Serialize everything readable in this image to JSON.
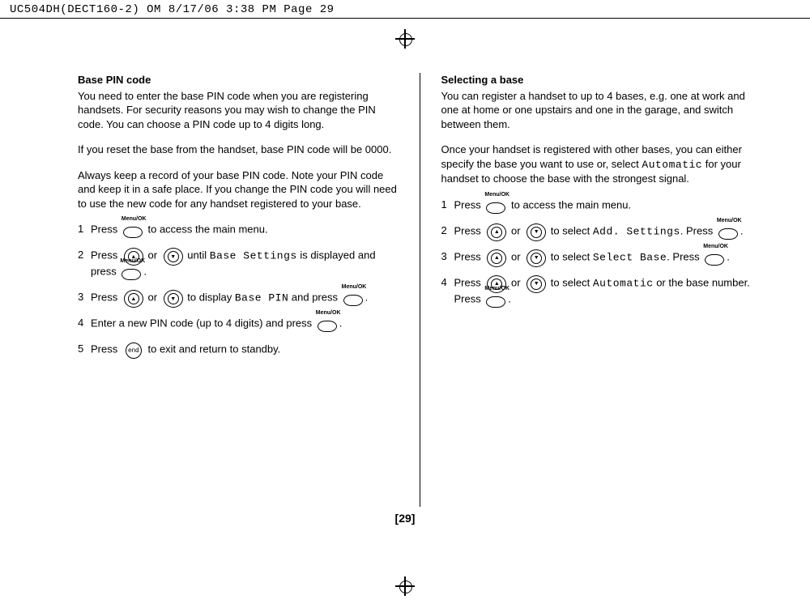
{
  "header": "UC504DH(DECT160-2) OM  8/17/06  3:38 PM  Page 29",
  "page_number": "[29]",
  "left": {
    "title": "Base PIN code",
    "p1": "You need to enter the base PIN code when you are registering handsets. For security reasons you may wish to change the PIN code. You can choose a PIN code up to 4 digits long.",
    "p2": "If you reset the base from the handset, base PIN code will be 0000.",
    "p3": "Always keep a record of your base PIN code. Note your PIN code and keep it in a safe place. If you change the PIN code you will need to use the new code for any handset registered to your base.",
    "s1a": "Press",
    "s1b": "to access the main menu.",
    "s2a": "Press",
    "s2b": "or",
    "s2c": "until",
    "s2d": "Base Settings",
    "s2e": "is displayed and press",
    "s3a": "Press",
    "s3b": "or",
    "s3c": "to display",
    "s3d": "Base PIN",
    "s3e": "and press",
    "s4a": "Enter a new PIN code (up to 4 digits) and press",
    "s5a": "Press",
    "s5b": "to exit and return to standby."
  },
  "right": {
    "title": "Selecting a base",
    "p1": "You can register a handset to up to 4 bases, e.g. one at work and one at home or one upstairs and one in the garage, and switch between them.",
    "p2a": "Once your handset is registered with other bases, you can either specify the base you want to use or, select",
    "p2b": "Automatic",
    "p2c": "for your handset to choose the base with the strongest signal.",
    "s1a": "Press",
    "s1b": "to access the main menu.",
    "s2a": "Press",
    "s2b": "or",
    "s2c": "to select",
    "s2d": "Add. Settings",
    "s2e": "Press",
    "s3a": "Press",
    "s3b": "or",
    "s3c": "to select",
    "s3d": "Select Base",
    "s3e": "Press",
    "s4a": "Press",
    "s4b": "or",
    "s4c": "to select",
    "s4d": "Automatic",
    "s4e": "or the base number. Press"
  },
  "keys": {
    "menuok": "Menu/OK",
    "up": "▲",
    "down": "▼",
    "end": "end"
  },
  "nums": {
    "n1": "1",
    "n2": "2",
    "n3": "3",
    "n4": "4",
    "n5": "5"
  }
}
